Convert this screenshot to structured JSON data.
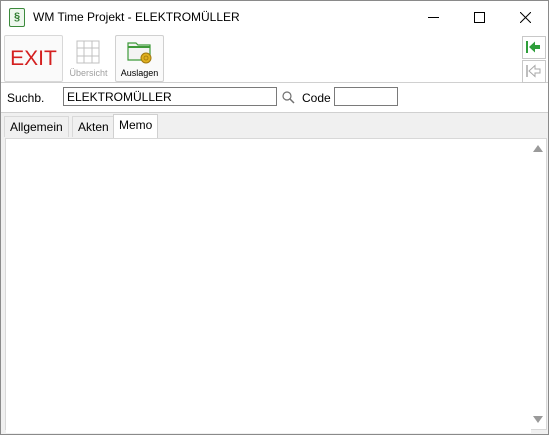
{
  "window": {
    "title": "WM Time Projekt - ELEKTROMÜLLER",
    "app_icon": "§"
  },
  "toolbar": {
    "exit_label": "EXIT",
    "uebersicht_label": "Übersicht",
    "auslagen_label": "Auslagen"
  },
  "search": {
    "label": "Suchb.",
    "value": "ELEKTROMÜLLER",
    "code_label": "Code",
    "code_value": ""
  },
  "tabs": [
    {
      "label": "Allgemein"
    },
    {
      "label": "Akten"
    },
    {
      "label": "Memo",
      "selected": true
    }
  ],
  "memo": {
    "value": ""
  },
  "icons": {
    "app": "document-section-icon",
    "minimize": "minimize-icon",
    "maximize": "maximize-icon",
    "close": "close-icon",
    "uebersicht": "grid-table-icon",
    "auslagen": "folder-coins-icon",
    "nav_first": "arrow-left-to-bar-icon",
    "nav_back": "arrow-left-bar-disabled-icon",
    "search": "magnifier-icon"
  },
  "colors": {
    "exit": "#d42020",
    "nav_arrow": "#2e9e3a",
    "folder": "#3f9a3a",
    "coin": "#e0b020"
  }
}
